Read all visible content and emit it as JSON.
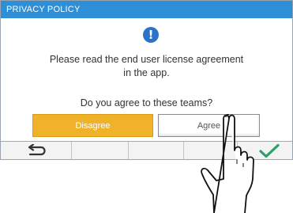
{
  "dialog": {
    "title": "PRIVACY POLICY",
    "message_line1": "Please read the end user license agreement",
    "message_line2": "in the app.",
    "question": "Do you agree to these teams?",
    "disagree_label": "Disagree",
    "agree_label": "Agree"
  },
  "toolbar": {
    "back_icon": "return-arrow-icon",
    "confirm_icon": "checkmark-icon"
  },
  "colors": {
    "title_bar": "#2e8ed6",
    "info_icon": "#2b73c8",
    "disagree_button": "#f0b228",
    "confirm_check": "#2aa16a"
  }
}
